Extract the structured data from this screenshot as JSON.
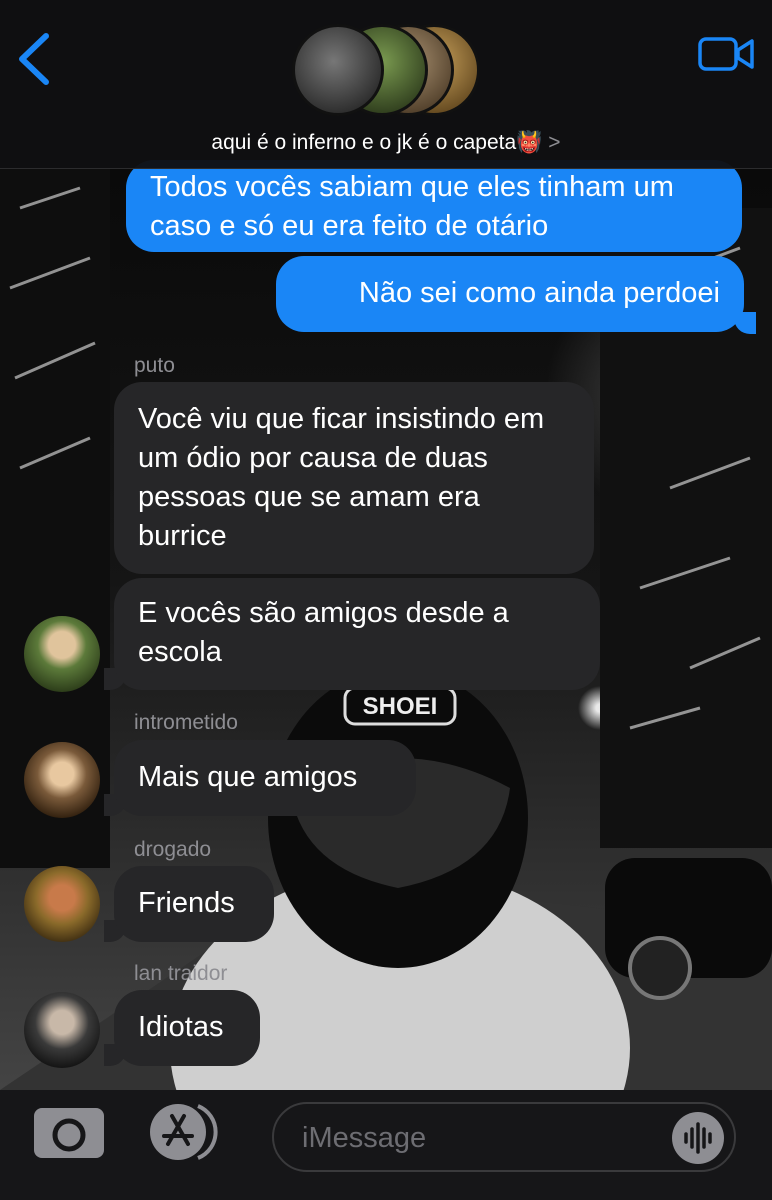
{
  "header": {
    "group_name": "aqui é o inferno e o jk é o capeta👹",
    "chevron": ">"
  },
  "messages": {
    "out_1": "Todos vocês sabiam que eles tinham um caso e só eu era feito de otário",
    "out_2": "Não sei como ainda perdoei",
    "sender_1": "puto",
    "in_1": "Você viu que ficar insistindo em um ódio por causa de duas pessoas que se amam era burrice",
    "in_2": "E vocês são amigos desde a escola",
    "sender_2": "intrometido",
    "in_3": "Mais que amigos",
    "sender_3": "drogado",
    "in_4": "Friends",
    "sender_4": "lan traidor",
    "in_5": "Idiotas"
  },
  "input": {
    "placeholder": "iMessage"
  },
  "colors": {
    "outgoing": "#1a86f6",
    "incoming": "#262628",
    "accent": "#1a86f6"
  },
  "icons": [
    "back-chevron-icon",
    "video-camera-icon",
    "camera-icon",
    "app-store-icon",
    "voice-waveform-icon"
  ]
}
